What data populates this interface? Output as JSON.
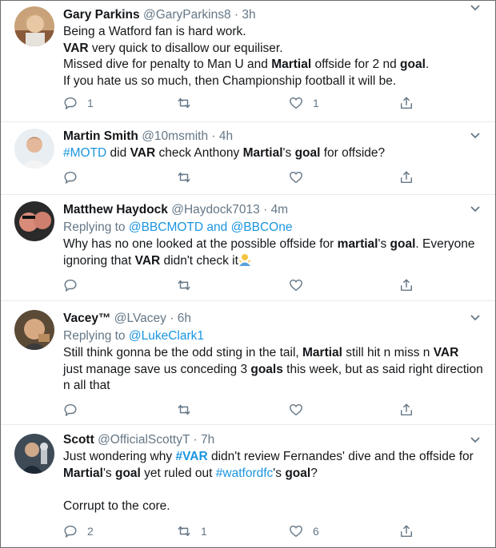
{
  "tweets": [
    {
      "name": "Gary Parkins",
      "handle": "@GaryParkins8",
      "time": "3h",
      "lines": [
        [
          {
            "t": "Being a Watford fan is hard work."
          }
        ],
        [
          {
            "t": "VAR",
            "b": true
          },
          {
            "t": " very quick to disallow our equiliser."
          }
        ],
        [
          {
            "t": "Missed dive for penalty to Man U and "
          },
          {
            "t": "Martial",
            "b": true
          },
          {
            "t": " offside for 2 nd "
          },
          {
            "t": "goal",
            "b": true
          },
          {
            "t": "."
          }
        ],
        [
          {
            "t": "If you hate us so much, then Championship football it will be."
          }
        ]
      ],
      "reply_count": "1",
      "retweet_count": "",
      "like_count": "1"
    },
    {
      "name": "Martin Smith",
      "handle": "@10msmith",
      "time": "4h",
      "lines": [
        [
          {
            "t": "#MOTD",
            "link": true
          },
          {
            "t": " did "
          },
          {
            "t": "VAR",
            "b": true
          },
          {
            "t": " check Anthony "
          },
          {
            "t": "Martial",
            "b": true
          },
          {
            "t": "'s "
          },
          {
            "t": "goal",
            "b": true
          },
          {
            "t": " for offside?"
          }
        ]
      ],
      "reply_count": "",
      "retweet_count": "",
      "like_count": ""
    },
    {
      "name": "Matthew Haydock",
      "handle": "@Haydock7013",
      "time": "4m",
      "replying_prefix": "Replying to ",
      "replying_to": "@BBCMOTD and @BBCOne",
      "lines": [
        [
          {
            "t": "Why has no one looked at the possible offside for "
          },
          {
            "t": "martial",
            "b": true
          },
          {
            "t": "'s "
          },
          {
            "t": "goal",
            "b": true
          },
          {
            "t": ". Everyone"
          }
        ],
        [
          {
            "t": "ignoring that "
          },
          {
            "t": "VAR",
            "b": true
          },
          {
            "t": " didn't check it"
          },
          {
            "emoji": "person-shrugging"
          }
        ]
      ],
      "reply_count": "",
      "retweet_count": "",
      "like_count": ""
    },
    {
      "name": "Vacey™",
      "handle": "@LVacey",
      "time": "6h",
      "replying_prefix": "Replying to ",
      "replying_to": "@LukeClark1",
      "lines": [
        [
          {
            "t": "Still think gonna be the odd sting in the tail, "
          },
          {
            "t": "Martial",
            "b": true
          },
          {
            "t": " still hit n miss n "
          },
          {
            "t": "VAR",
            "b": true
          }
        ],
        [
          {
            "t": "just manage save us conceding 3 "
          },
          {
            "t": "goals",
            "b": true
          },
          {
            "t": " this week, but as said right direction"
          }
        ],
        [
          {
            "t": "n all that"
          }
        ]
      ],
      "reply_count": "",
      "retweet_count": "",
      "like_count": ""
    },
    {
      "name": "Scott",
      "handle": "@OfficialScottyT",
      "time": "7h",
      "lines": [
        [
          {
            "t": "Just wondering why "
          },
          {
            "t": "#VAR",
            "link": true,
            "b": true
          },
          {
            "t": " didn't review Fernandes' dive and the offside for"
          }
        ],
        [
          {
            "t": "Martial",
            "b": true
          },
          {
            "t": "'s "
          },
          {
            "t": "goal",
            "b": true
          },
          {
            "t": " yet ruled out "
          },
          {
            "t": "#watfordfc",
            "link": true
          },
          {
            "t": "'s "
          },
          {
            "t": "goal",
            "b": true
          },
          {
            "t": "?"
          }
        ],
        [
          {
            "t": ""
          }
        ],
        [
          {
            "t": "Corrupt to the core."
          }
        ]
      ],
      "reply_count": "2",
      "retweet_count": "1",
      "like_count": "6"
    }
  ],
  "colors": {
    "link": "#1b95e0",
    "muted": "#657786",
    "text": "#14171a",
    "divider": "#e6ecf0"
  },
  "icons": [
    "reply-icon",
    "retweet-icon",
    "like-icon",
    "share-icon",
    "chevron-down-icon"
  ]
}
